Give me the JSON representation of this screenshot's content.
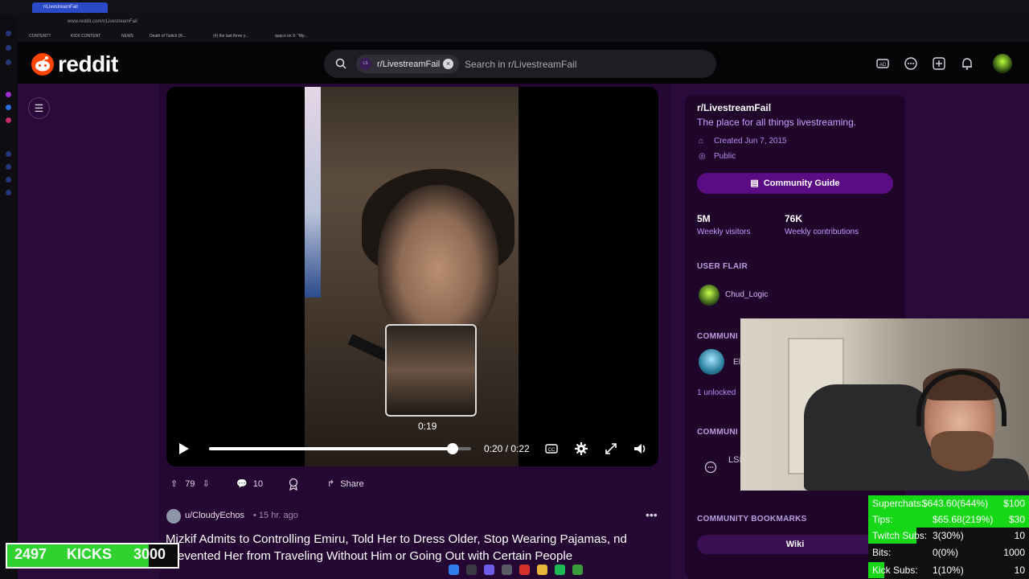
{
  "browser": {
    "tab_title": "r/LivestreamFail",
    "url": "www.reddit.com/r/LivestreamFail",
    "bookmarks": [
      "CONTENT?",
      "KICK CONTENT",
      "NEWS",
      "Death of Twitch (R...",
      "(4) the last three y...",
      "quqco on X: \"My..."
    ]
  },
  "header": {
    "logo_text": "reddit",
    "search_chip_avatar": "LS",
    "search_chip_label": "r/LivestreamFail",
    "search_placeholder": "Search in r/LivestreamFail",
    "icons": [
      "advertise-icon",
      "chat-icon",
      "create-post-icon",
      "notifications-icon",
      "user-avatar"
    ]
  },
  "video": {
    "preview_time": "0:19",
    "timecode": "0:20 / 0:22",
    "progress": 0.93
  },
  "post": {
    "votes": "79",
    "comments": "10",
    "share_label": "Share"
  },
  "next_post": {
    "user": "u/CloudyEchos",
    "time": "• 15 hr. ago",
    "title": "Mizkif Admits to Controlling Emiru, Told Her to Dress Older, Stop Wearing Pajamas, nd Prevented Her from Traveling Without Him or Going Out with Certain People"
  },
  "sidebar": {
    "name": "r/LivestreamFail",
    "description": "The place for all things livestreaming.",
    "created": "Created Jun 7, 2015",
    "visibility": "Public",
    "guide_label": "Community Guide",
    "stats": [
      {
        "value": "5M",
        "label": "Weekly visitors"
      },
      {
        "value": "76K",
        "label": "Weekly contributions"
      }
    ],
    "user_flair_heading": "USER FLAIR",
    "flair_name": "Chud_Logic",
    "community_heading_1": "COMMUNI",
    "community_avatar_text": "El",
    "unlocked_text": "1 unlocked",
    "community_heading_2": "COMMUNI",
    "community_2_text": "LSI",
    "bookmarks_heading": "COMMUNITY BOOKMARKS",
    "wiki_label": "Wiki"
  },
  "stream_stats": [
    {
      "label": "Superchats:",
      "value": "$643.60(644%)",
      "goal": "$100",
      "fill": 1.0
    },
    {
      "label": "Tips:",
      "value": "$65.68(219%)",
      "goal": "$30",
      "fill": 1.0
    },
    {
      "label": "Twitch Subs:",
      "value": "3(30%)",
      "goal": "10",
      "fill": 0.3
    },
    {
      "label": "Bits:",
      "value": "0(0%)",
      "goal": "1000",
      "fill": 0.0
    },
    {
      "label": "Kick Subs:",
      "value": "1(10%)",
      "goal": "10",
      "fill": 0.1
    }
  ],
  "kicks": {
    "current": "2497",
    "label": "KICKS",
    "goal": "3000",
    "fill": 0.83
  },
  "colors": {
    "reddit_orange": "#ff4500",
    "page_purple": "#2a0a3a",
    "accent_purple": "#c69cff",
    "stat_green": "#17d817"
  }
}
